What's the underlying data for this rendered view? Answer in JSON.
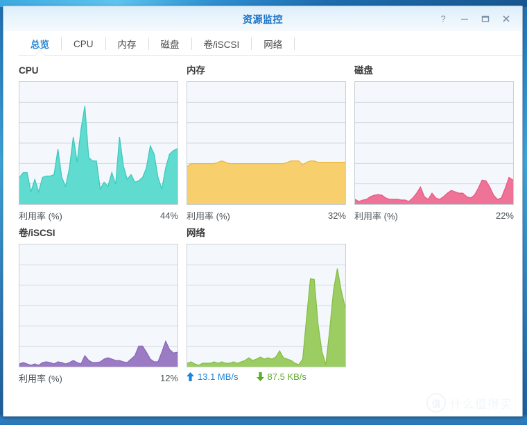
{
  "window": {
    "title": "资源监控",
    "controls": [
      {
        "name": "help-button",
        "glyph": "?"
      },
      {
        "name": "minimize-button",
        "glyph": "–"
      },
      {
        "name": "maximize-button",
        "glyph": "□"
      },
      {
        "name": "close-button",
        "glyph": "✕"
      }
    ]
  },
  "tabs": [
    {
      "label": "总览",
      "active": true
    },
    {
      "label": "CPU",
      "active": false
    },
    {
      "label": "内存",
      "active": false
    },
    {
      "label": "磁盘",
      "active": false
    },
    {
      "label": "卷/iSCSI",
      "active": false
    },
    {
      "label": "网络",
      "active": false
    }
  ],
  "panels": {
    "cpu": {
      "title": "CPU",
      "footer_label": "利用率 (%)",
      "value": "44%"
    },
    "memory": {
      "title": "内存",
      "footer_label": "利用率 (%)",
      "value": "32%"
    },
    "disk": {
      "title": "磁盘",
      "footer_label": "利用率 (%)",
      "value": "22%"
    },
    "volume": {
      "title": "卷/iSCSI",
      "footer_label": "利用率 (%)",
      "value": "12%"
    },
    "network": {
      "title": "网络",
      "upload_value": "13.1 MB/s",
      "download_value": "87.5 KB/s",
      "upload_icon": "arrow-up-icon",
      "download_icon": "arrow-down-icon"
    }
  },
  "watermark": {
    "badge": "值",
    "text": "什么值得买"
  },
  "colors": {
    "accent": "#2784d4",
    "title": "#1b72c4",
    "cpu_fill": "#5fdbd0",
    "cpu_stroke": "#3ec9bd",
    "memory_fill": "#f7cf6c",
    "memory_stroke": "#eab941",
    "disk_fill": "#ef7396",
    "disk_stroke": "#e65b84",
    "volume_fill": "#9b7cc4",
    "volume_stroke": "#8867b6",
    "network_fill": "#9ccd63",
    "network_stroke": "#86bd48",
    "upload": "#1b84d8",
    "download": "#5da928",
    "chart_bg": "#f4f8fc",
    "grid": "#d3d8dd",
    "chart_border": "#c8cfd6"
  },
  "chart_data": [
    {
      "type": "area",
      "title": "CPU",
      "ylabel": "利用率 (%)",
      "current_value": 44,
      "unit": "%",
      "ylim": [
        0,
        100
      ],
      "gridlines": 5,
      "grid": true,
      "color": "#5fdbd0",
      "values": [
        22,
        26,
        26,
        10,
        20,
        10,
        22,
        23,
        23,
        24,
        45,
        22,
        15,
        30,
        55,
        32,
        62,
        80,
        38,
        35,
        35,
        12,
        18,
        14,
        26,
        16,
        55,
        28,
        20,
        24,
        18,
        19,
        22,
        30,
        48,
        40,
        22,
        12,
        30,
        40,
        44,
        46
      ]
    },
    {
      "type": "area",
      "title": "内存",
      "ylabel": "利用率 (%)",
      "current_value": 32,
      "unit": "%",
      "ylim": [
        0,
        100
      ],
      "gridlines": 5,
      "grid": true,
      "color": "#f7cf6c",
      "values": [
        31,
        33,
        33,
        33,
        33,
        33,
        33,
        33,
        34,
        35,
        34,
        33,
        33,
        33,
        33,
        33,
        33,
        33,
        33,
        33,
        33,
        33,
        33,
        33,
        33,
        33,
        34,
        35,
        35,
        35,
        32,
        34,
        35,
        35,
        34,
        34,
        34,
        34,
        34,
        34,
        34,
        34
      ]
    },
    {
      "type": "area",
      "title": "磁盘",
      "ylabel": "利用率 (%)",
      "current_value": 22,
      "unit": "%",
      "ylim": [
        0,
        100
      ],
      "gridlines": 5,
      "grid": true,
      "color": "#ef7396",
      "values": [
        4,
        2,
        3,
        4,
        6,
        7,
        8,
        7,
        5,
        4,
        4,
        4,
        3,
        3,
        2,
        5,
        9,
        14,
        6,
        4,
        9,
        5,
        4,
        6,
        9,
        11,
        10,
        9,
        9,
        6,
        5,
        7,
        13,
        20,
        19,
        14,
        7,
        4,
        5,
        13,
        22,
        20
      ]
    },
    {
      "type": "area",
      "title": "卷/iSCSI",
      "ylabel": "利用率 (%)",
      "current_value": 12,
      "unit": "%",
      "ylim": [
        0,
        100
      ],
      "gridlines": 5,
      "grid": true,
      "color": "#9b7cc4",
      "values": [
        2,
        3,
        2,
        1,
        2,
        1,
        3,
        4,
        3,
        2,
        4,
        3,
        2,
        3,
        5,
        3,
        2,
        9,
        5,
        3,
        3,
        4,
        6,
        7,
        6,
        5,
        5,
        4,
        3,
        6,
        9,
        17,
        17,
        12,
        6,
        4,
        4,
        12,
        21,
        14,
        11,
        12
      ]
    },
    {
      "type": "area",
      "title": "网络",
      "ylabel": "",
      "upload": "13.1 MB/s",
      "download": "87.5 KB/s",
      "gridlines": 5,
      "grid": true,
      "color": "#9ccd63",
      "values": [
        3,
        4,
        2,
        1,
        3,
        3,
        3,
        4,
        3,
        4,
        3,
        3,
        4,
        3,
        4,
        5,
        7,
        5,
        6,
        8,
        6,
        7,
        6,
        8,
        13,
        7,
        6,
        5,
        3,
        2,
        6,
        40,
        72,
        71,
        34,
        12,
        2,
        30,
        62,
        80,
        62,
        48
      ]
    }
  ]
}
